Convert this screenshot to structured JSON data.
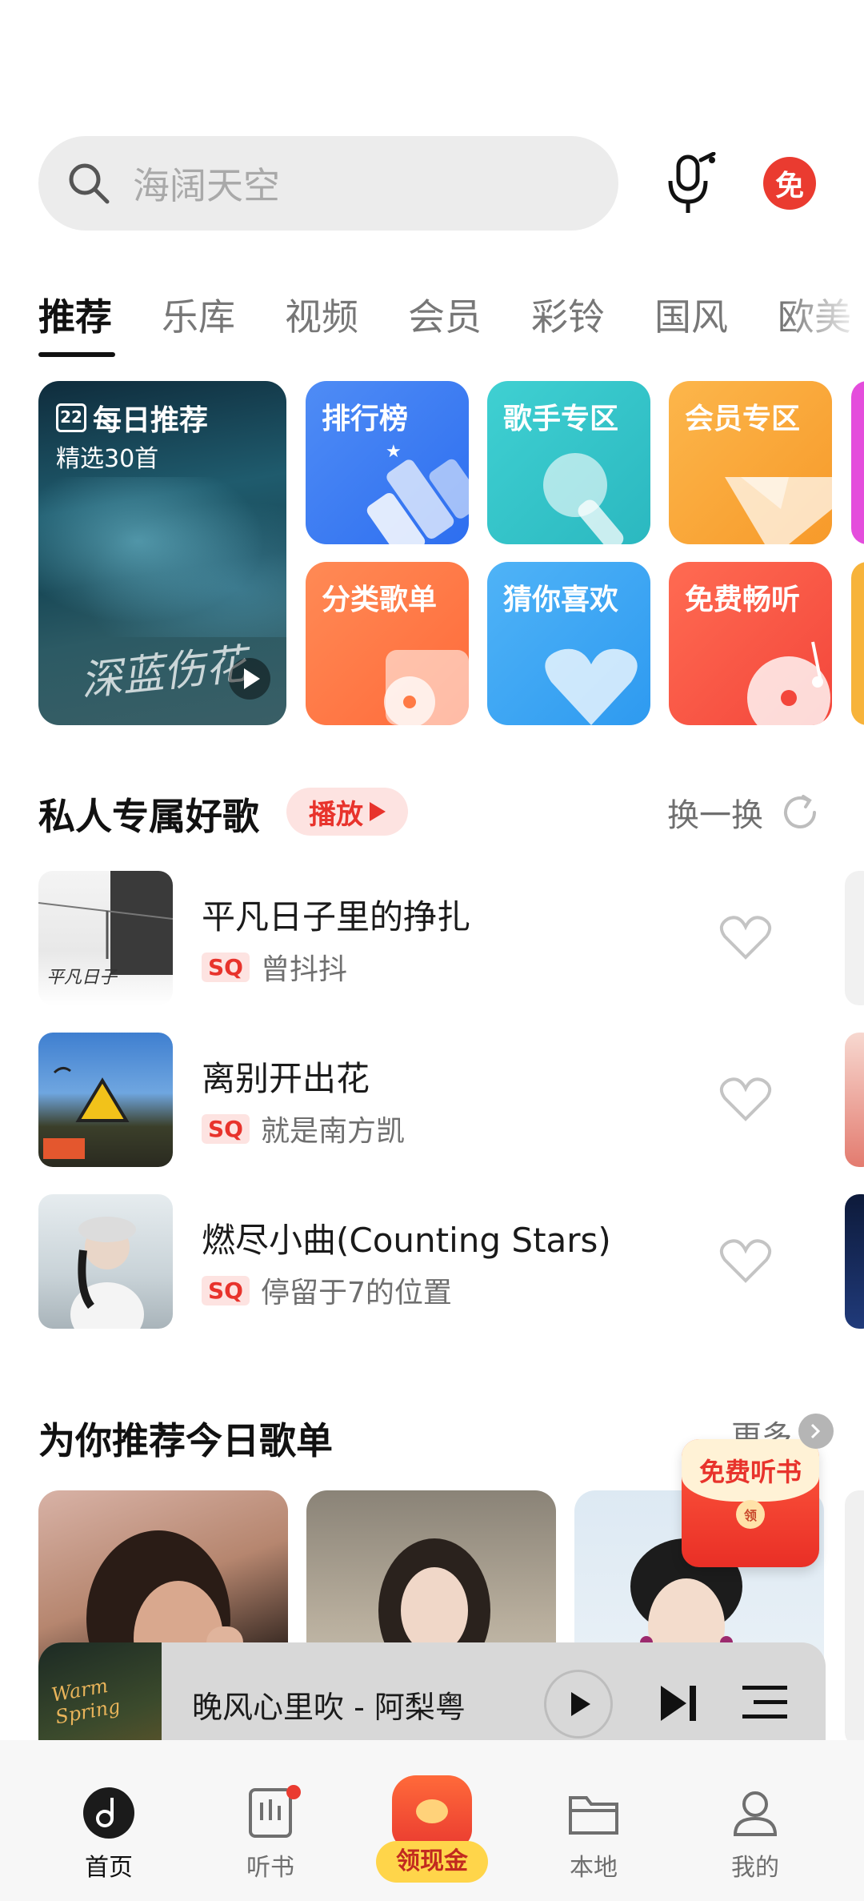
{
  "search": {
    "placeholder": "海阔天空"
  },
  "header": {
    "vip_badge": "免"
  },
  "tabs": [
    "推荐",
    "乐库",
    "视频",
    "会员",
    "彩铃",
    "国风",
    "欧美"
  ],
  "daily": {
    "title": "每日推荐",
    "subtitle": "精选30首",
    "calendar_day": "22",
    "signature": "深蓝伤花"
  },
  "tiles": [
    {
      "label": "排行榜"
    },
    {
      "label": "歌手专区"
    },
    {
      "label": "会员专区"
    },
    {
      "label": "分类歌单"
    },
    {
      "label": "猜你喜欢"
    },
    {
      "label": "免费畅听"
    }
  ],
  "private_songs": {
    "title": "私人专属好歌",
    "play_label": "播放",
    "swap_label": "换一换",
    "quality_tag": "SQ",
    "songs": [
      {
        "name": "平凡日子里的挣扎",
        "artist": "曾抖抖"
      },
      {
        "name": "离别开出花",
        "artist": "就是南方凯"
      },
      {
        "name": "燃尽小曲(Counting Stars)",
        "artist": "停留于7的位置"
      }
    ]
  },
  "playlists": {
    "title": "为你推荐今日歌单",
    "more_label": "更多"
  },
  "floating_packet": {
    "label": "免费听书",
    "coin": "领"
  },
  "player": {
    "now_playing": "晚风心里吹 - 阿梨粤",
    "cover_text": "Warm Spring"
  },
  "nav": {
    "items": [
      "首页",
      "听书",
      "领现金",
      "本地",
      "我的"
    ]
  },
  "colors": {
    "accent": "#ea3b30",
    "tag_bg": "#fde3e1"
  }
}
